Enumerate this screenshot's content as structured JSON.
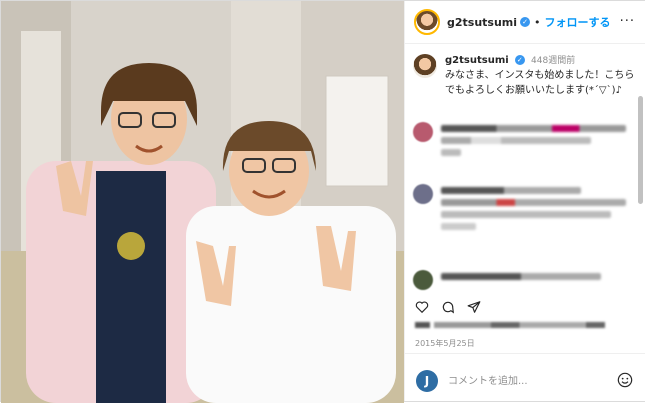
{
  "header": {
    "username": "g2tsutsumi",
    "follow_label": "フォローする",
    "separator": "•",
    "more_label": "···"
  },
  "caption": {
    "username": "g2tsutsumi",
    "time": "448週間前",
    "text": "みなさま、インスタも始めました！こちらでもよろしくお願いいたします(*´▽`)♪"
  },
  "post": {
    "date": "2015年5月25日"
  },
  "comment_box": {
    "avatar_letter": "J",
    "placeholder": "コメントを追加..."
  },
  "colors": {
    "follow_blue": "#0095f6",
    "verified_blue": "#3897f0",
    "avatar_ring": "#ffb800",
    "muted_text": "#8e8e8e"
  },
  "icons": [
    "verified-badge-icon",
    "more-options-icon",
    "heart-icon",
    "comment-icon",
    "share-icon",
    "emoji-icon"
  ]
}
